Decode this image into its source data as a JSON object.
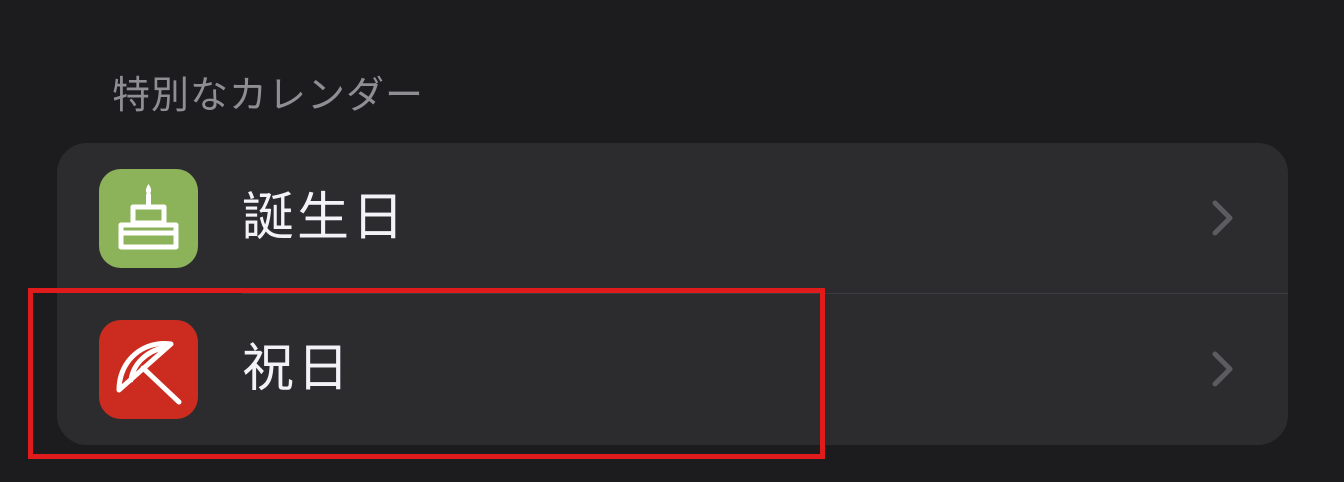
{
  "section": {
    "header": "特別なカレンダー"
  },
  "calendars": [
    {
      "label": "誕生日",
      "icon": "birthday-cake-icon",
      "icon_color": "#8db35a"
    },
    {
      "label": "祝日",
      "icon": "holiday-umbrella-icon",
      "icon_color": "#cc2c1f"
    }
  ],
  "colors": {
    "background": "#1c1c1e",
    "group_background": "#2c2c2e",
    "highlight": "#e01b1b",
    "chevron": "#5b5b60"
  }
}
